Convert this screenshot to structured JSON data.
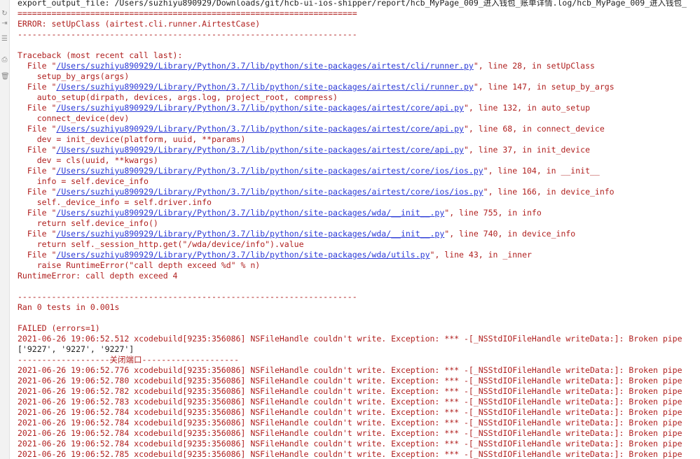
{
  "console": {
    "export_line": "export_output_file: /Users/suzhiyu890929/Downloads/git/hcb-ui-ios-shipper/report/hcb_MyPage_009_进入钱包_账单详情.log/hcb_MyPage_009_进入钱包_",
    "sep_double": "======================================================================",
    "error_header": "ERROR: setUpClass (airtest.cli.runner.AirtestCase)",
    "sep_single": "----------------------------------------------------------------------",
    "traceback_header": "Traceback (most recent call last):",
    "frames": [
      {
        "path": "/Users/suzhiyu890929/Library/Python/3.7/lib/python/site-packages/airtest/cli/runner.py",
        "tail": "\", line 28, in setUpClass",
        "code": "setup_by_args(args)"
      },
      {
        "path": "/Users/suzhiyu890929/Library/Python/3.7/lib/python/site-packages/airtest/cli/runner.py",
        "tail": "\", line 147, in setup_by_args",
        "code": "auto_setup(dirpath, devices, args.log, project_root, compress)"
      },
      {
        "path": "/Users/suzhiyu890929/Library/Python/3.7/lib/python/site-packages/airtest/core/api.py",
        "tail": "\", line 132, in auto_setup",
        "code": "connect_device(dev)"
      },
      {
        "path": "/Users/suzhiyu890929/Library/Python/3.7/lib/python/site-packages/airtest/core/api.py",
        "tail": "\", line 68, in connect_device",
        "code": "dev = init_device(platform, uuid, **params)"
      },
      {
        "path": "/Users/suzhiyu890929/Library/Python/3.7/lib/python/site-packages/airtest/core/api.py",
        "tail": "\", line 37, in init_device",
        "code": "dev = cls(uuid, **kwargs)"
      },
      {
        "path": "/Users/suzhiyu890929/Library/Python/3.7/lib/python/site-packages/airtest/core/ios/ios.py",
        "tail": "\", line 104, in __init__",
        "code": "info = self.device_info"
      },
      {
        "path": "/Users/suzhiyu890929/Library/Python/3.7/lib/python/site-packages/airtest/core/ios/ios.py",
        "tail": "\", line 166, in device_info",
        "code": "self._device_info = self.driver.info"
      },
      {
        "path": "/Users/suzhiyu890929/Library/Python/3.7/lib/python/site-packages/wda/__init__.py",
        "tail": "\", line 755, in info",
        "code": "return self.device_info()"
      },
      {
        "path": "/Users/suzhiyu890929/Library/Python/3.7/lib/python/site-packages/wda/__init__.py",
        "tail": "\", line 740, in device_info",
        "code": "return self._session_http.get(\"/wda/device/info\").value"
      },
      {
        "path": "/Users/suzhiyu890929/Library/Python/3.7/lib/python/site-packages/wda/utils.py",
        "tail": "\", line 43, in _inner",
        "code": "raise RuntimeError(\"call depth exceed %d\" % n)"
      }
    ],
    "runtime_error": "RuntimeError: call depth exceed 4",
    "ran_line": "Ran 0 tests in 0.001s",
    "failed_line": "FAILED (errors=1)",
    "nsfile_first": "2021-06-26 19:06:52.512 xcodebuild[9235:356086] NSFileHandle couldn't write. Exception: *** -[_NSStdIOFileHandle writeData:]: Broken pipe",
    "ports_line": "['9227', '9227', '9227']",
    "close_port_line": "-------------------关闭端口--------------------",
    "nsfile_lines": [
      "2021-06-26 19:06:52.776 xcodebuild[9235:356086] NSFileHandle couldn't write. Exception: *** -[_NSStdIOFileHandle writeData:]: Broken pipe",
      "2021-06-26 19:06:52.780 xcodebuild[9235:356086] NSFileHandle couldn't write. Exception: *** -[_NSStdIOFileHandle writeData:]: Broken pipe",
      "2021-06-26 19:06:52.782 xcodebuild[9235:356086] NSFileHandle couldn't write. Exception: *** -[_NSStdIOFileHandle writeData:]: Broken pipe",
      "2021-06-26 19:06:52.783 xcodebuild[9235:356086] NSFileHandle couldn't write. Exception: *** -[_NSStdIOFileHandle writeData:]: Broken pipe",
      "2021-06-26 19:06:52.784 xcodebuild[9235:356086] NSFileHandle couldn't write. Exception: *** -[_NSStdIOFileHandle writeData:]: Broken pipe",
      "2021-06-26 19:06:52.784 xcodebuild[9235:356086] NSFileHandle couldn't write. Exception: *** -[_NSStdIOFileHandle writeData:]: Broken pipe",
      "2021-06-26 19:06:52.784 xcodebuild[9235:356086] NSFileHandle couldn't write. Exception: *** -[_NSStdIOFileHandle writeData:]: Broken pipe",
      "2021-06-26 19:06:52.784 xcodebuild[9235:356086] NSFileHandle couldn't write. Exception: *** -[_NSStdIOFileHandle writeData:]: Broken pipe",
      "2021-06-26 19:06:52.785 xcodebuild[9235:356086] NSFileHandle couldn't write. Exception: *** -[_NSStdIOFileHandle writeData:]: Broken pipe",
      "2021-06-26 19:06:52.785 xcodebuild[9235:356086] NSFileHandle couldn't write. Exception: *** -[_NSStdIOFileHandle writeData:]: Broken pipe"
    ]
  },
  "gutter_icons": [
    {
      "name": "rerun-icon",
      "glyph": "↻"
    },
    {
      "name": "soft-wrap-icon",
      "glyph": "⇥"
    },
    {
      "name": "settings-icon",
      "glyph": "☰"
    },
    {
      "name": "print-icon",
      "glyph": "⎙"
    },
    {
      "name": "clear-all-icon",
      "glyph": "🗑"
    }
  ],
  "colors": {
    "error_text": "#b0201f",
    "link": "#2b3ad6",
    "plain_text": "#1e1e1e",
    "gutter_bg": "#f2f2f2"
  }
}
